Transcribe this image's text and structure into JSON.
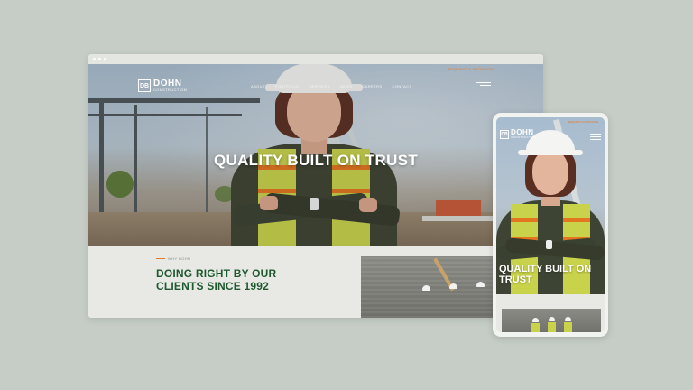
{
  "desktop": {
    "top_link": "REQUEST A PROPOSAL",
    "logo": {
      "mark": "DB",
      "name": "DOHN",
      "sub": "CONSTRUCTION"
    },
    "nav": [
      "ABOUT",
      "PORTFOLIO",
      "SERVICES",
      "NEWS",
      "CAREERS",
      "CONTACT"
    ],
    "hero_title": "QUALITY BUILT ON TRUST",
    "section": {
      "eyebrow": "WHY DOHN",
      "title": "DOING RIGHT BY OUR CLIENTS SINCE 1992"
    }
  },
  "mobile": {
    "top_link": "REQUEST A PROPOSAL",
    "logo": {
      "mark": "DB",
      "name": "DOHN",
      "sub": "CONSTRUCTION"
    },
    "hero_title": "QUALITY BUILT ON TRUST"
  },
  "colors": {
    "accent": "#e07a2e",
    "heading_green": "#1f5a2f",
    "background": "#c5cdc6"
  },
  "icons": [
    "menu-icon",
    "logo-mark"
  ]
}
